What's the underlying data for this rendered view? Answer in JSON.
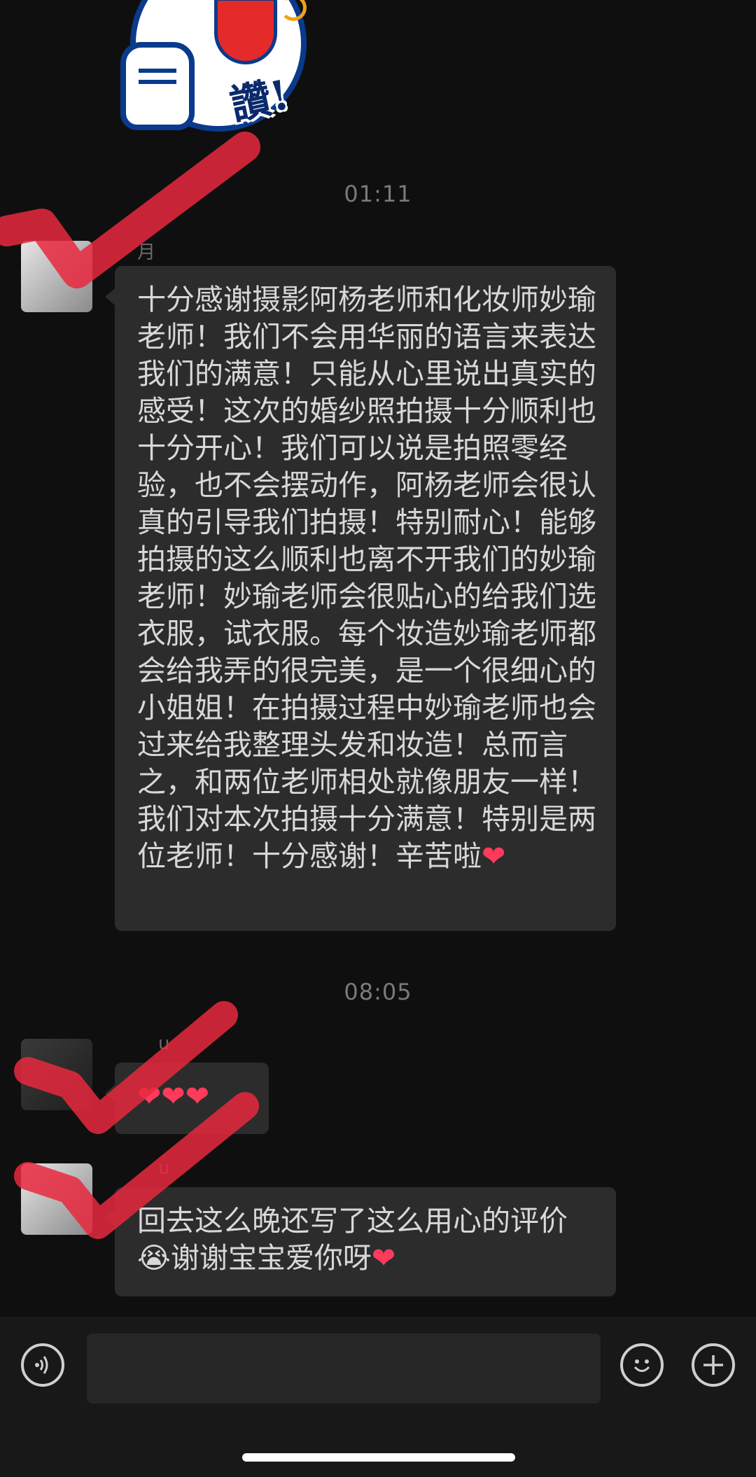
{
  "sticker": {
    "text": "讚!"
  },
  "messages": [
    {
      "time": "01:11",
      "sender": "月",
      "text": "十分感谢摄影阿杨老师和化妆师妙瑜老师！我们不会用华丽的语言来表达我们的满意！只能从心里说出真实的感受！这次的婚纱照拍摄十分顺利也十分开心！我们可以说是拍照零经验，也不会摆动作，阿杨老师会很认真的引导我们拍摄！特别耐心！能够拍摄的这么顺利也离不开我们的妙瑜老师！妙瑜老师会很贴心的给我们选衣服，试衣服。每个妆造妙瑜老师都会给我弄的很完美，是一个很细心的小姐姐！在拍摄过程中妙瑜老师也会过来给我整理头发和妆造！总而言之，和两位老师相处就像朋友一样！我们对本次拍摄十分满意！特别是两位老师！十分感谢！辛苦啦",
      "emoji": "❤"
    },
    {
      "time": "08:05",
      "sender": "u",
      "text": "❤❤❤"
    },
    {
      "sender": "u",
      "text_line1": "回去这么晚还写了这么用心的评价",
      "text_line2_emoji": "😭",
      "text_line2": "谢谢宝宝爱你呀",
      "emoji": "❤"
    }
  ],
  "input_bar": {
    "voice_icon": "voice-icon",
    "emoji_icon": "smiley-icon",
    "plus_icon": "plus-icon",
    "input_value": ""
  },
  "colors": {
    "bubble": "#2c2c2c",
    "redaction": "#e8293e",
    "heart": "#ff3b5c"
  }
}
